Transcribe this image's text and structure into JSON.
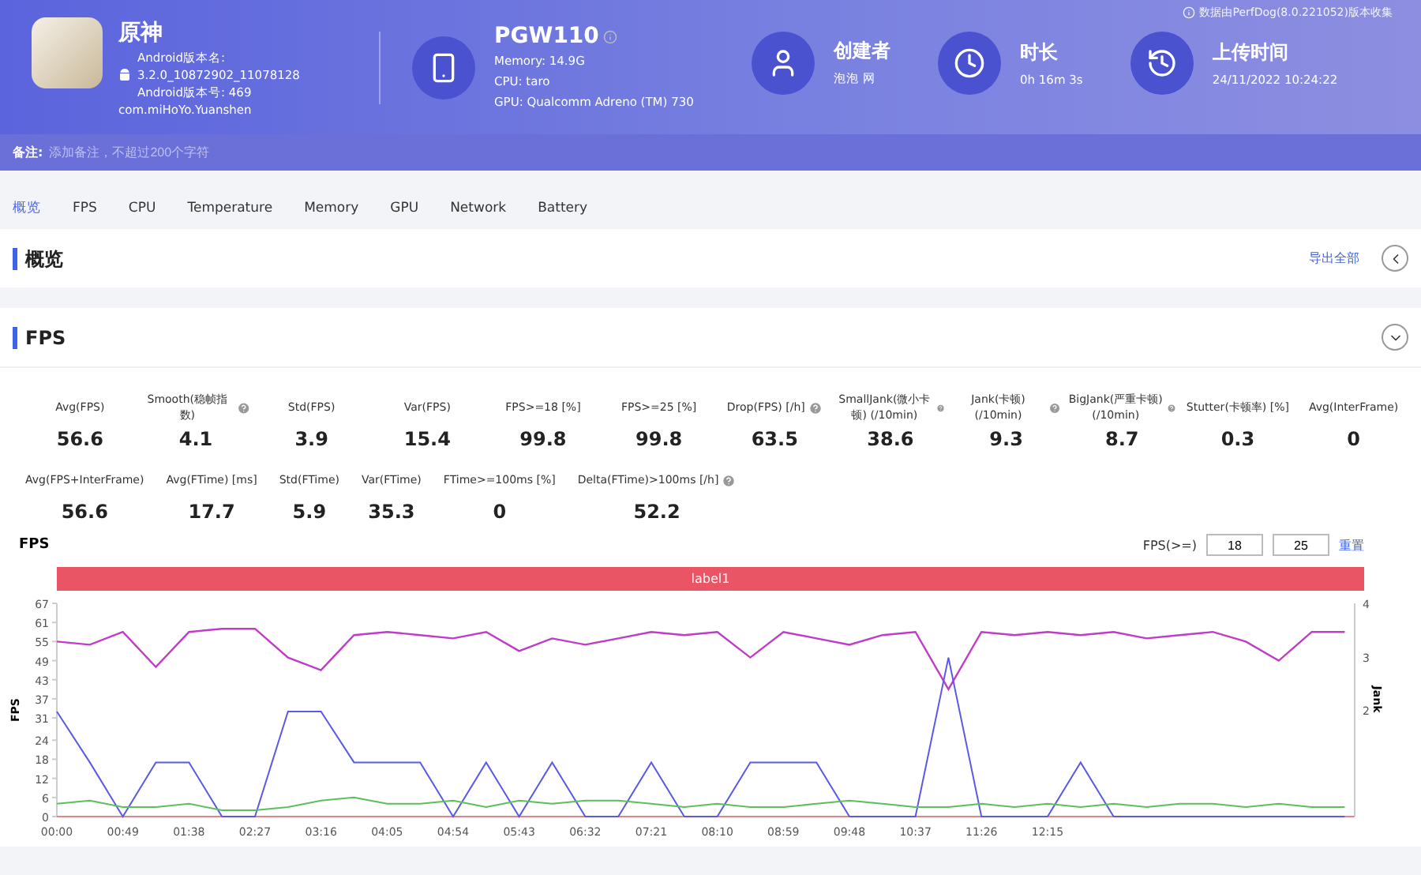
{
  "header": {
    "app": {
      "name": "原神",
      "version_name_label": "Android版本名:",
      "version_name": "3.2.0_10872902_11078128",
      "version_code": "Android版本号: 469",
      "package": "com.miHoYo.Yuanshen"
    },
    "device": {
      "model": "PGW110",
      "memory": "Memory: 14.9G",
      "cpu": "CPU: taro",
      "gpu": "GPU: Qualcomm Adreno (TM) 730"
    },
    "info_items": [
      {
        "kind": "creator",
        "title": "创建者",
        "value": "泡泡 网"
      },
      {
        "kind": "duration",
        "title": "时长",
        "value": "0h 16m 3s"
      },
      {
        "kind": "upload",
        "title": "上传时间",
        "value": "24/11/2022 10:24:22"
      }
    ],
    "source_note": "数据由PerfDog(8.0.221052)版本收集"
  },
  "note": {
    "label": "备注:",
    "placeholder": "添加备注，不超过200个字符"
  },
  "tabs": [
    {
      "label": "概览",
      "selected": true
    },
    {
      "label": "FPS",
      "selected": false
    },
    {
      "label": "CPU",
      "selected": false
    },
    {
      "label": "Temperature",
      "selected": false
    },
    {
      "label": "Memory",
      "selected": false
    },
    {
      "label": "GPU",
      "selected": false
    },
    {
      "label": "Network",
      "selected": false
    },
    {
      "label": "Battery",
      "selected": false
    }
  ],
  "overview": {
    "title": "概览",
    "export": "导出全部",
    "expanded": false
  },
  "fps_section": {
    "title": "FPS",
    "expanded": true,
    "stat_rows": [
      [
        {
          "label": "Avg(FPS)",
          "value": "56.6",
          "help": false
        },
        {
          "label": "Smooth(稳帧指数)",
          "value": "4.1",
          "help": true
        },
        {
          "label": "Std(FPS)",
          "value": "3.9",
          "help": false
        },
        {
          "label": "Var(FPS)",
          "value": "15.4",
          "help": false
        },
        {
          "label": "FPS>=18 [%]",
          "value": "99.8",
          "help": false
        },
        {
          "label": "FPS>=25 [%]",
          "value": "99.8",
          "help": false
        },
        {
          "label": "Drop(FPS) [/h]",
          "value": "63.5",
          "help": true
        },
        {
          "label": "SmallJank(微小卡顿) (/10min)",
          "value": "38.6",
          "help": true
        },
        {
          "label": "Jank(卡顿) (/10min)",
          "value": "9.3",
          "help": true
        },
        {
          "label": "BigJank(严重卡顿) (/10min)",
          "value": "8.7",
          "help": true
        },
        {
          "label": "Stutter(卡顿率) [%]",
          "value": "0.3",
          "help": false
        },
        {
          "label": "Avg(InterFrame)",
          "value": "0",
          "help": false
        }
      ],
      [
        {
          "label": "Avg(FPS+InterFrame)",
          "value": "56.6",
          "help": false
        },
        {
          "label": "Avg(FTime) [ms]",
          "value": "17.7",
          "help": false
        },
        {
          "label": "Std(FTime)",
          "value": "5.9",
          "help": false
        },
        {
          "label": "Var(FTime)",
          "value": "35.3",
          "help": false
        },
        {
          "label": "FTime>=100ms [%]",
          "value": "0",
          "help": false
        },
        {
          "label": "Delta(FTime)>100ms [/h]",
          "value": "52.2",
          "help": true
        }
      ]
    ],
    "chart": {
      "title": "FPS",
      "threshold_label": "FPS(>=)",
      "thresholds": [
        "18",
        "25"
      ],
      "reset": "重置",
      "label_bar": "label1",
      "right_axis": {
        "label": "Jank",
        "ticks": [
          "4",
          "3",
          "2"
        ]
      },
      "chart_data": {
        "type": "line",
        "ylabel": "FPS",
        "ylim": [
          0,
          67
        ],
        "categories": [
          "00:00",
          null,
          "00:49",
          null,
          "01:38",
          null,
          "02:27",
          null,
          "03:16",
          null,
          "04:05",
          null,
          "04:54",
          null,
          "05:43",
          null,
          "06:32",
          null,
          "07:21",
          null,
          "08:10",
          null,
          "08:59",
          null,
          "09:48",
          null,
          "10:37",
          null,
          "11:26",
          null,
          "12:15",
          null,
          null,
          null,
          null,
          null,
          null,
          null,
          null,
          null
        ],
        "yticks": [
          0,
          6,
          12,
          18,
          24,
          31,
          37,
          43,
          49,
          55,
          61,
          67
        ],
        "series": [
          {
            "color": "#c03cc8",
            "values": [
              55,
              54,
              58,
              47,
              58,
              59,
              59,
              50,
              46,
              57,
              58,
              57,
              56,
              58,
              52,
              56,
              54,
              56,
              58,
              57,
              58,
              50,
              58,
              56,
              54,
              57,
              58,
              40,
              58,
              57,
              58,
              57,
              58,
              56,
              57,
              58,
              55,
              49,
              58,
              58
            ]
          },
          {
            "color": "#5a5ae6",
            "values": [
              33,
              17,
              0,
              17,
              17,
              0,
              0,
              33,
              33,
              17,
              17,
              17,
              0,
              17,
              0,
              17,
              0,
              0,
              17,
              0,
              0,
              17,
              17,
              17,
              0,
              0,
              0,
              50,
              0,
              0,
              0,
              17,
              0,
              0,
              0,
              0,
              0,
              0,
              0,
              0
            ]
          },
          {
            "color": "#5cbf5c",
            "values": [
              4,
              5,
              3,
              3,
              4,
              2,
              2,
              3,
              5,
              6,
              4,
              4,
              5,
              3,
              5,
              4,
              5,
              5,
              4,
              3,
              4,
              3,
              3,
              4,
              5,
              4,
              3,
              3,
              4,
              3,
              4,
              3,
              4,
              3,
              4,
              4,
              3,
              4,
              3,
              3
            ]
          }
        ]
      }
    }
  }
}
